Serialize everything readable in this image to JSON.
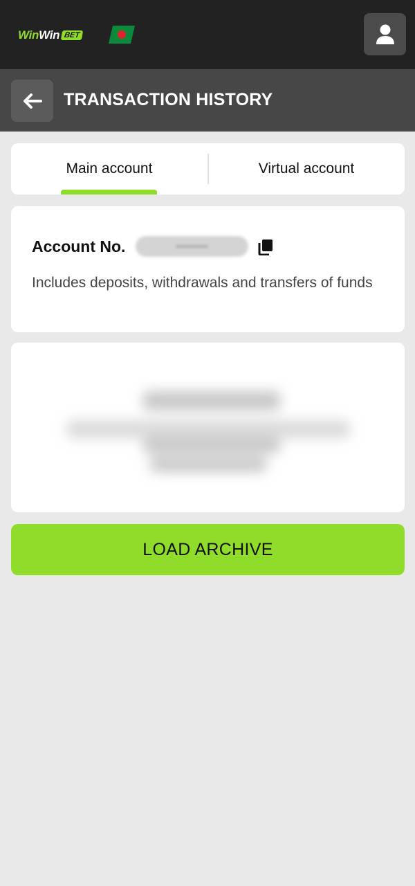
{
  "header": {
    "logo": {
      "part1": "Win",
      "part2": "Win",
      "badge": "BET"
    },
    "flag_icon": "bangladesh-flag",
    "profile_icon": "user-icon"
  },
  "titlebar": {
    "back_icon": "arrow-left-icon",
    "title": "TRANSACTION HISTORY"
  },
  "tabs": [
    {
      "label": "Main account",
      "active": true
    },
    {
      "label": "Virtual account",
      "active": false
    }
  ],
  "account": {
    "label": "Account No.",
    "number": "•••••••••",
    "copy_icon": "copy-icon",
    "description": "Includes deposits, withdrawals and transfers of funds"
  },
  "actions": {
    "load_archive": "LOAD ARCHIVE"
  },
  "colors": {
    "accent": "#8fdc2a",
    "topbar": "#222222",
    "titlebar": "#474747",
    "background": "#e9e9e9"
  }
}
